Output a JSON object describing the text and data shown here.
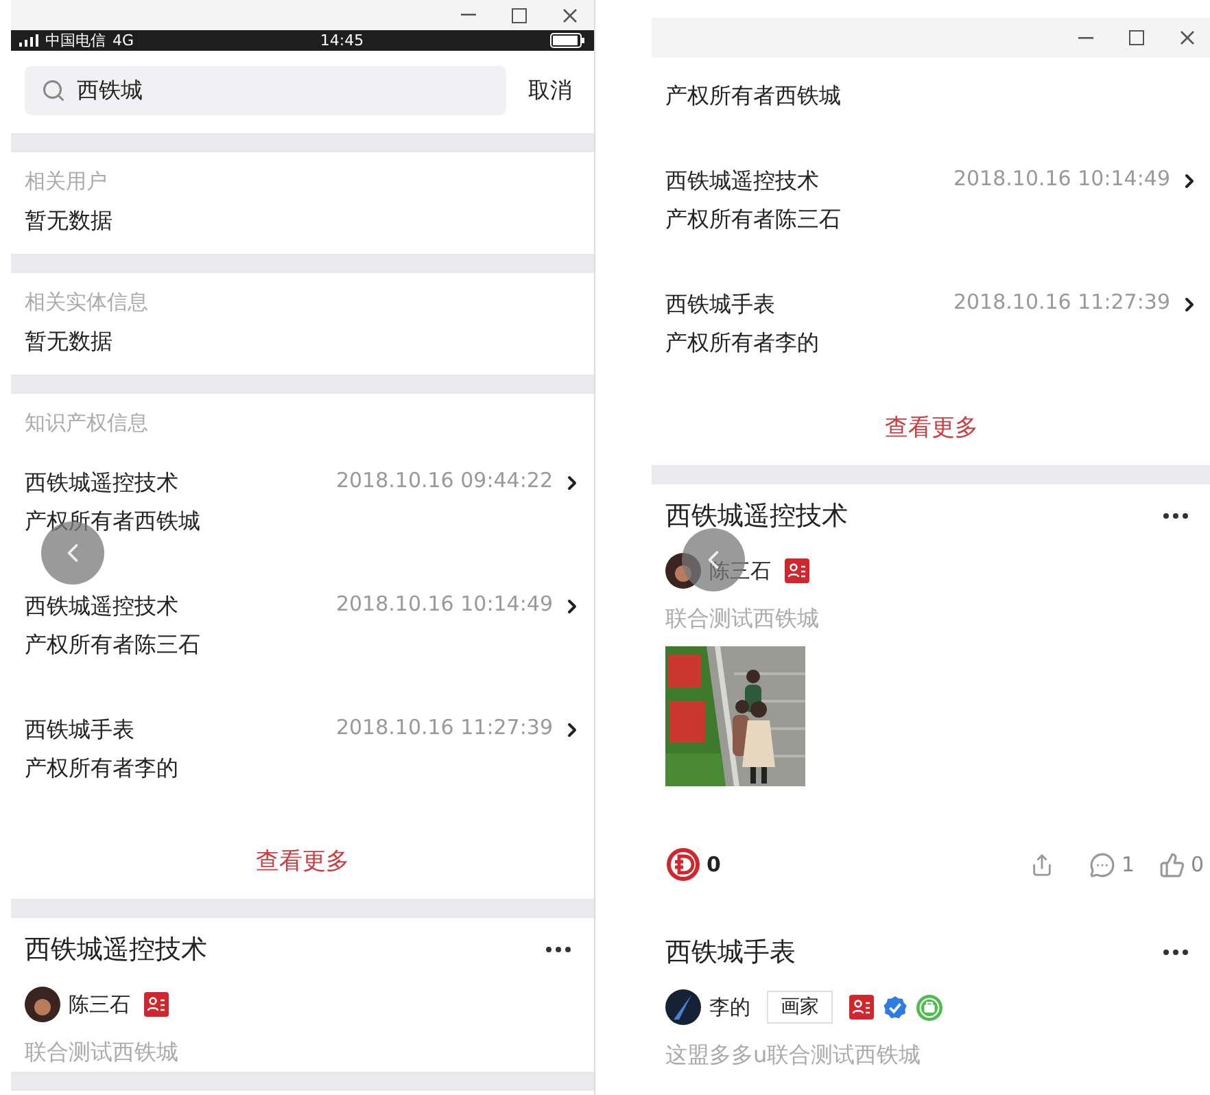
{
  "left_window": {
    "status_bar": {
      "carrier": "中国电信",
      "network": "4G",
      "time": "14:45"
    },
    "search": {
      "value": "西铁城",
      "cancel": "取消"
    },
    "sections": [
      {
        "title": "相关用户",
        "empty_text": "暂无数据"
      },
      {
        "title": "相关实体信息",
        "empty_text": "暂无数据"
      }
    ],
    "ip_section": {
      "title": "知识产权信息",
      "items": [
        {
          "name": "西铁城遥控技术",
          "owner": "产权所有者西铁城",
          "date": "2018.10.16 09:44:22"
        },
        {
          "name": "西铁城遥控技术",
          "owner": "产权所有者陈三石",
          "date": "2018.10.16 10:14:49"
        },
        {
          "name": "西铁城手表",
          "owner": "产权所有者李的",
          "date": "2018.10.16 11:27:39"
        }
      ],
      "more": "查看更多"
    },
    "posts": [
      {
        "title": "西铁城遥控技术",
        "author": "陈三石",
        "badges": [
          {
            "kind": "card"
          }
        ],
        "text": "联合测试西铁城"
      }
    ]
  },
  "right_window": {
    "ip_items": [
      {
        "owner": "产权所有者西铁城"
      },
      {
        "name": "西铁城遥控技术",
        "owner": "产权所有者陈三石",
        "date": "2018.10.16 10:14:49"
      },
      {
        "name": "西铁城手表",
        "owner": "产权所有者李的",
        "date": "2018.10.16 11:27:39"
      }
    ],
    "more": "查看更多",
    "posts": [
      {
        "title": "西铁城遥控技术",
        "author": "陈三石",
        "badges": [
          {
            "kind": "card"
          }
        ],
        "text": "联合测试西铁城",
        "image": {
          "kind": "picture"
        },
        "reward": "0",
        "comments": "1",
        "likes": "0"
      },
      {
        "title": "西铁城手表",
        "author": "李的",
        "tag": "画家",
        "badges": [
          {
            "kind": "card"
          },
          {
            "kind": "verified"
          },
          {
            "kind": "shop"
          }
        ],
        "text": "这盟多多u联合测试西铁城"
      }
    ]
  }
}
